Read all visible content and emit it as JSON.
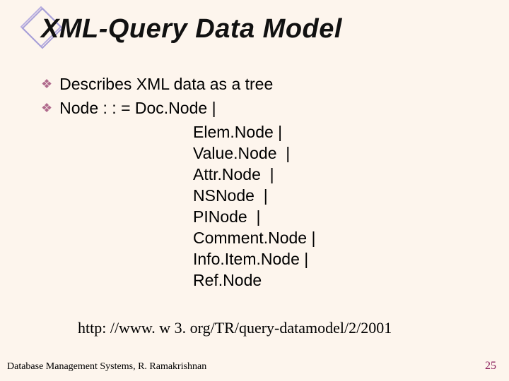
{
  "title": "XML-Query Data Model",
  "bullets": {
    "b1": "Describes XML data as a tree",
    "b2": "Node : : =  Doc.Node |"
  },
  "nodes": {
    "n1": "Elem.Node |",
    "n2": "Value.Node  |",
    "n3": "Attr.Node  |",
    "n4": "NSNode  |",
    "n5": "PINode  |",
    "n6": "Comment.Node |",
    "n7": "Info.Item.Node |",
    "n8": "Ref.Node"
  },
  "url": "http: //www. w 3. org/TR/query-datamodel/2/2001",
  "footer": {
    "left": "Database Management Systems, R. Ramakrishnan",
    "page": "25"
  },
  "icons": {
    "bullet": "❖"
  }
}
